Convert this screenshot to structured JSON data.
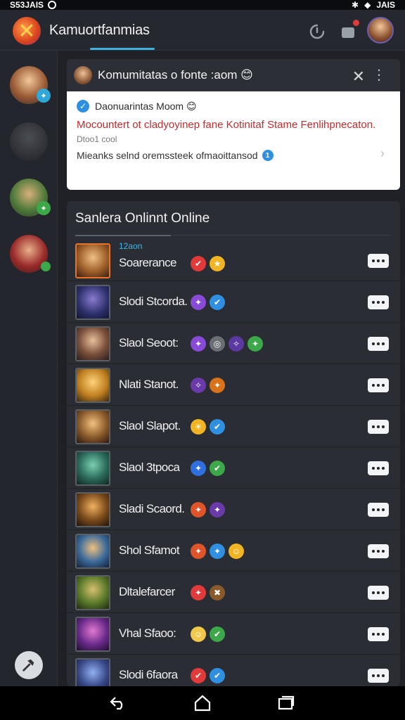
{
  "status_bar": {
    "left_text": "S53JAIS",
    "right_text": "JAIS"
  },
  "app": {
    "title": "Kamuortfanmias"
  },
  "icons": {
    "refresh": "refresh-icon",
    "notifications": "notification-icon",
    "close": "close-icon",
    "more": "more-vertical-icon"
  },
  "community": {
    "header_title": "Komumitatas o fonte :aom 😊",
    "sender": "Daonuarintas Moom 😊",
    "alert": "Mocountert ot cladyoyinep fane Kotinitaf Stame Fenlihpnecaton.",
    "small": "Dtoo1 cool",
    "footer": "Mieanks selnd oremssteek ofmaoittansod",
    "footer_badge": "1"
  },
  "online": {
    "title": "Sanlera Onlinnt Online",
    "players": [
      {
        "name": "Soarerance",
        "sub": "12aon",
        "badges": [
          [
            "#e03a3a",
            "✔"
          ],
          [
            "#f1b422",
            "★"
          ]
        ]
      },
      {
        "name": "Slodi Stcorda.",
        "sub": "",
        "badges": [
          [
            "#8a4ad8",
            "✦"
          ],
          [
            "#2f8fe0",
            "✔"
          ]
        ]
      },
      {
        "name": "Slaol Seoot:",
        "sub": "",
        "badges": [
          [
            "#8a4ad8",
            "✦"
          ],
          [
            "#6b6f75",
            "◎"
          ],
          [
            "#5a3aa0",
            "✧"
          ],
          [
            "#3da84a",
            "✦"
          ]
        ]
      },
      {
        "name": "Nlati Stanot.",
        "sub": "",
        "badges": [
          [
            "#6a3aa8",
            "✧"
          ],
          [
            "#d8731b",
            "✦"
          ]
        ]
      },
      {
        "name": "Slaol Slapot.",
        "sub": "",
        "badges": [
          [
            "#f1b422",
            "☀"
          ],
          [
            "#2f8fe0",
            "✔"
          ]
        ]
      },
      {
        "name": "Slaol 3tpoca",
        "sub": "",
        "badges": [
          [
            "#2f6fe0",
            "✦"
          ],
          [
            "#3da84a",
            "✔"
          ]
        ]
      },
      {
        "name": "Sladi Scaord.",
        "sub": "",
        "badges": [
          [
            "#e0542a",
            "✦"
          ],
          [
            "#6a3aa8",
            "✦"
          ]
        ]
      },
      {
        "name": "Shol Sfamot",
        "sub": "",
        "badges": [
          [
            "#e0542a",
            "✦"
          ],
          [
            "#2f8fe0",
            "✦"
          ],
          [
            "#f1b422",
            "☺"
          ]
        ]
      },
      {
        "name": "Dltalefarcer",
        "sub": "",
        "badges": [
          [
            "#e03a3a",
            "✦"
          ],
          [
            "#8a5a2a",
            "✖"
          ]
        ]
      },
      {
        "name": "Vhal Sfaoo:",
        "sub": "",
        "badges": [
          [
            "#f1c84a",
            "☺"
          ],
          [
            "#3da84a",
            "✔"
          ]
        ]
      },
      {
        "name": "Slodi 6faora",
        "sub": "",
        "badges": [
          [
            "#e03a3a",
            "✔"
          ],
          [
            "#2f8fe0",
            "✔"
          ]
        ]
      }
    ]
  },
  "colors": {
    "accent": "#3fb2e0",
    "background": "#1f2126",
    "alert_red": "#c42b2b"
  }
}
